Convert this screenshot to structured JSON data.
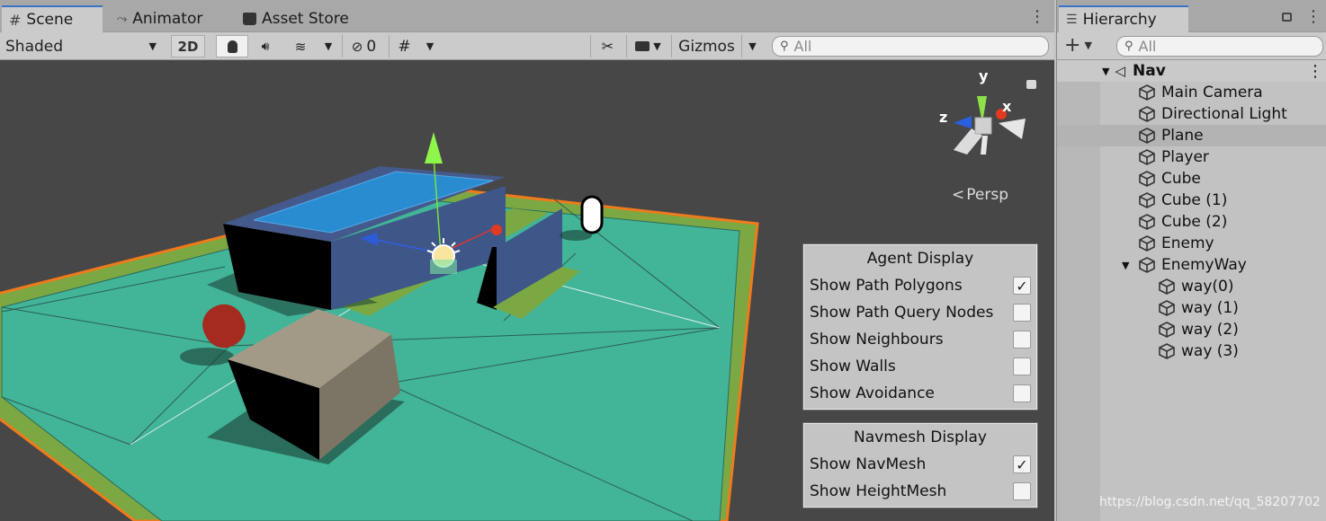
{
  "scene_tabs": [
    {
      "label": "Scene",
      "icon": "grid-icon"
    },
    {
      "label": "Animator",
      "icon": "animator-icon"
    },
    {
      "label": "Asset Store",
      "icon": "store-bag-icon"
    }
  ],
  "toolbar": {
    "shading_mode": "Shaded",
    "mode_2d": "2D",
    "hidden_count": "0",
    "gizmos_label": "Gizmos",
    "search_placeholder": "All"
  },
  "viewport": {
    "axis_y": "y",
    "axis_x": "x",
    "axis_z": "z",
    "projection_label": "Persp"
  },
  "agent_display": {
    "title": "Agent Display",
    "options": [
      {
        "label": "Show Path Polygons",
        "checked": true
      },
      {
        "label": "Show Path Query Nodes",
        "checked": false
      },
      {
        "label": "Show Neighbours",
        "checked": false
      },
      {
        "label": "Show Walls",
        "checked": false
      },
      {
        "label": "Show Avoidance",
        "checked": false
      }
    ]
  },
  "navmesh_display": {
    "title": "Navmesh Display",
    "options": [
      {
        "label": "Show NavMesh",
        "checked": true
      },
      {
        "label": "Show HeightMesh",
        "checked": false
      }
    ]
  },
  "hierarchy": {
    "tab_label": "Hierarchy",
    "search_placeholder": "All",
    "scene_name": "Nav",
    "items": [
      {
        "label": "Main Camera",
        "depth": 1,
        "selected": false
      },
      {
        "label": "Directional Light",
        "depth": 1,
        "selected": false
      },
      {
        "label": "Plane",
        "depth": 1,
        "selected": true
      },
      {
        "label": "Player",
        "depth": 1,
        "selected": false
      },
      {
        "label": "Cube",
        "depth": 1,
        "selected": false
      },
      {
        "label": "Cube (1)",
        "depth": 1,
        "selected": false
      },
      {
        "label": "Cube (2)",
        "depth": 1,
        "selected": false
      },
      {
        "label": "Enemy",
        "depth": 1,
        "selected": false
      },
      {
        "label": "EnemyWay",
        "depth": 1,
        "selected": false,
        "expanded": true
      },
      {
        "label": "way(0)",
        "depth": 2,
        "selected": false
      },
      {
        "label": "way (1)",
        "depth": 2,
        "selected": false
      },
      {
        "label": "way (2)",
        "depth": 2,
        "selected": false
      },
      {
        "label": "way (3)",
        "depth": 2,
        "selected": false
      }
    ]
  },
  "watermark": "https://blog.csdn.net/qq_58207702"
}
